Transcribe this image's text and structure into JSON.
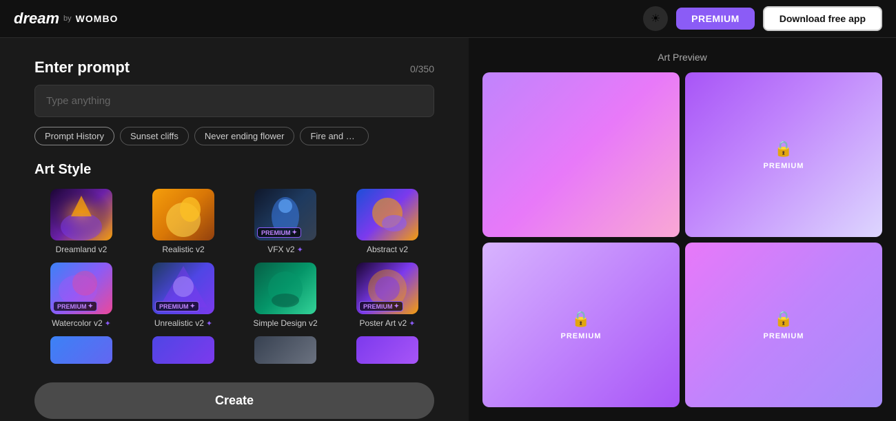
{
  "header": {
    "logo_dream": "dream",
    "logo_by": "by",
    "logo_wombo": "WOMBO",
    "theme_icon": "☀",
    "premium_label": "PREMIUM",
    "download_label": "Download free app"
  },
  "prompt": {
    "title": "Enter prompt",
    "counter": "0/350",
    "placeholder": "Type anything",
    "chips": [
      {
        "label": "Prompt History",
        "active": true
      },
      {
        "label": "Sunset cliffs"
      },
      {
        "label": "Never ending flower"
      },
      {
        "label": "Fire and w..."
      }
    ]
  },
  "art_style": {
    "title": "Art Style",
    "items": [
      {
        "label": "Dreamland v2",
        "premium": false,
        "spark": false
      },
      {
        "label": "Realistic v2",
        "premium": false,
        "spark": false
      },
      {
        "label": "VFX v2",
        "premium": true,
        "spark": true
      },
      {
        "label": "Abstract v2",
        "premium": false,
        "spark": false
      },
      {
        "label": "Watercolor v2",
        "premium": true,
        "spark": true
      },
      {
        "label": "Unrealistic v2",
        "premium": true,
        "spark": true
      },
      {
        "label": "Simple Design v2",
        "premium": false,
        "spark": false
      },
      {
        "label": "Poster Art v2",
        "premium": true,
        "spark": true
      }
    ]
  },
  "create_button": "Create",
  "art_preview": {
    "title": "Art Preview",
    "cells": [
      {
        "type": "empty"
      },
      {
        "type": "premium",
        "label": "PREMIUM"
      },
      {
        "type": "premium",
        "label": "PREMIUM"
      },
      {
        "type": "premium",
        "label": "PREMIUM"
      }
    ]
  }
}
